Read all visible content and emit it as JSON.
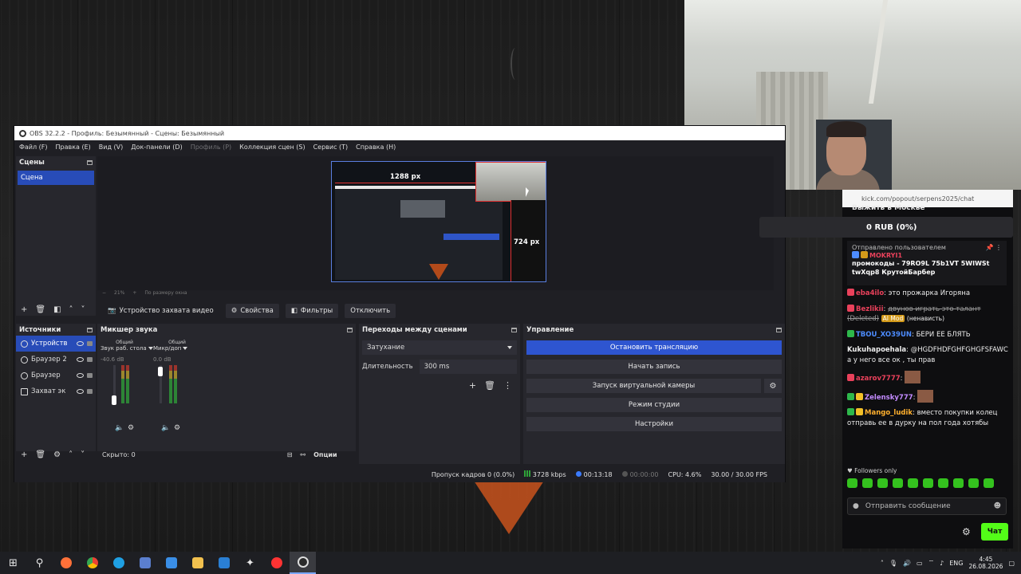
{
  "obs": {
    "title": "OBS 32.2.2 - Профиль: Безымянный - Сцены: Безымянный",
    "menu": [
      "Файл (F)",
      "Правка (E)",
      "Вид (V)",
      "Док-панели (D)",
      "Профиль (P)",
      "Коллекция сцен (S)",
      "Сервис (T)",
      "Справка (H)"
    ],
    "scenes": {
      "title": "Сцены",
      "items": [
        "Сцена"
      ]
    },
    "preview": {
      "width_label": "1288 px",
      "height_label": "724 px",
      "zoom": "21%",
      "fit_label": "По размеру окна"
    },
    "source_toolbar": {
      "device": "Устройство захвата видео",
      "properties": "Свойства",
      "filters": "Фильтры",
      "disable": "Отключить"
    },
    "sources": {
      "title": "Источники",
      "items": [
        "Устройств",
        "Браузер 2",
        "Браузер",
        "Захват эк"
      ],
      "hidden_label": "Скрыто: 0",
      "options": "Опции"
    },
    "mixer": {
      "title": "Микшер звука",
      "channels": [
        {
          "cap": "Общий",
          "name": "Звук раб. стола",
          "db": "-40.6 dB"
        },
        {
          "cap": "Общий",
          "name": "Микр/доп",
          "db": "0.0 dB"
        }
      ],
      "ticks": [
        "0",
        "-6",
        "-12",
        "-18",
        "-24",
        "-30",
        "-36",
        "-42",
        "-48",
        "-54",
        "-60"
      ]
    },
    "transitions": {
      "title": "Переходы между сценами",
      "selected": "Затухание",
      "duration_label": "Длительность",
      "duration_value": "300 ms"
    },
    "controls": {
      "title": "Управление",
      "stop_stream": "Остановить трансляцию",
      "start_record": "Начать запись",
      "virtual_cam": "Запуск виртуальной камеры",
      "studio_mode": "Режим студии",
      "settings": "Настройки"
    },
    "status": {
      "dropped": "Пропуск кадров 0 (0.0%)",
      "bitrate": "3728 kbps",
      "stream_time": "00:13:18",
      "record_time": "00:00:00",
      "cpu": "CPU: 4.6%",
      "fps": "30.00 / 30.00 FPS"
    }
  },
  "chat": {
    "url": "kick.com/popout/serpens2025/chat",
    "overlay_title": "Выжить в Москве",
    "goal": "0 RUB (0%)",
    "pinned": {
      "from": "Отправлено пользователем",
      "user": "MOKRYI1",
      "message": "промокоды - 79RO9L 75b1VT 5WIWSt twXqp8 КрутойБарбер"
    },
    "messages": [
      {
        "nick": "eba4ilo",
        "text": "это прожарка Игоряна",
        "color": "#e9415b"
      },
      {
        "nick": "Bezlikii",
        "text": "двунов играть это талант (Deleted)",
        "tag": "AI Mod",
        "extra": "(ненависть)",
        "color": "#e9415b"
      },
      {
        "nick": "TBOU_XO39UN",
        "text": "БЕРИ ЕЕ БЛЯТЬ",
        "color": "#4d8cff"
      },
      {
        "nick": "Kukuhapoehala",
        "text": "@HGDFHDFGHFGHGFSFAWC а у него все ок , ты прав",
        "color": "#f0f0f0"
      },
      {
        "nick": "azarov7777",
        "text": "",
        "color": "#e9415b"
      },
      {
        "nick": "Zelensky777",
        "text": "",
        "color": "#c38bff"
      },
      {
        "nick": "Mango_ludik",
        "text": "вместо покупки колец отправь ее в дурку на пол года хотябы",
        "color": "#ffb02e"
      }
    ],
    "followers": "Followers only",
    "send_placeholder": "Отправить сообщение",
    "chat_button": "Чат"
  },
  "taskbar": {
    "lang": "ENG",
    "time": "4:45",
    "date": "26.08.2026"
  }
}
